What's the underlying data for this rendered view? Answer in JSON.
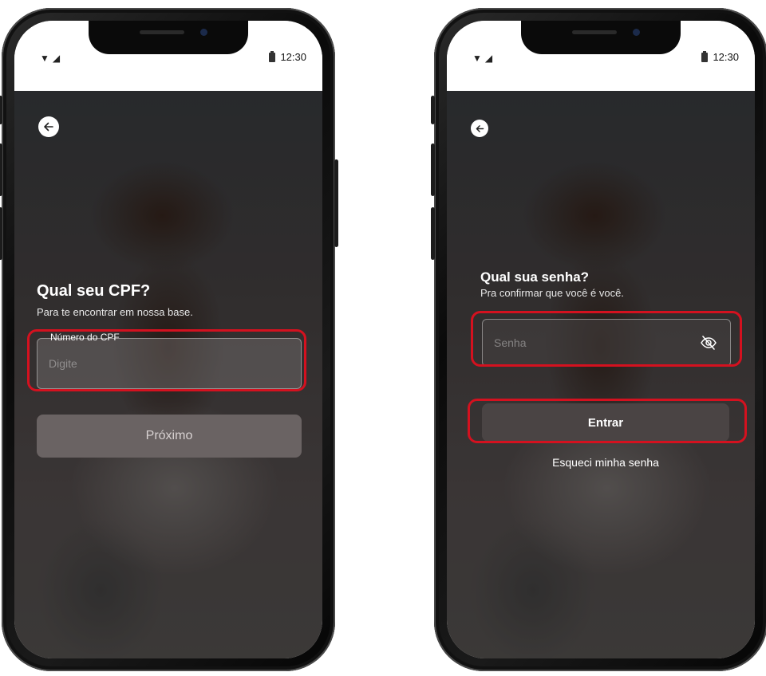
{
  "status_bar": {
    "time": "12:30"
  },
  "screen_cpf": {
    "title": "Qual seu CPF?",
    "subtitle": "Para te encontrar em nossa base.",
    "cpf_field": {
      "label": "Número do CPF",
      "placeholder": "Digite"
    },
    "next_button": "Próximo"
  },
  "screen_password": {
    "title": "Qual sua senha?",
    "subtitle": "Pra confirmar que você é você.",
    "password_field": {
      "placeholder": "Senha"
    },
    "submit_button": "Entrar",
    "forgot_link": "Esqueci minha senha"
  },
  "icons": {
    "back": "arrow-left-icon",
    "visibility": "eye-off-icon",
    "wifi": "wifi-icon",
    "signal": "signal-icon",
    "battery": "battery-icon"
  },
  "colors": {
    "highlight": "#d4111f",
    "primary_button_left": "#6a6363",
    "primary_button_right": "#4a4444"
  }
}
